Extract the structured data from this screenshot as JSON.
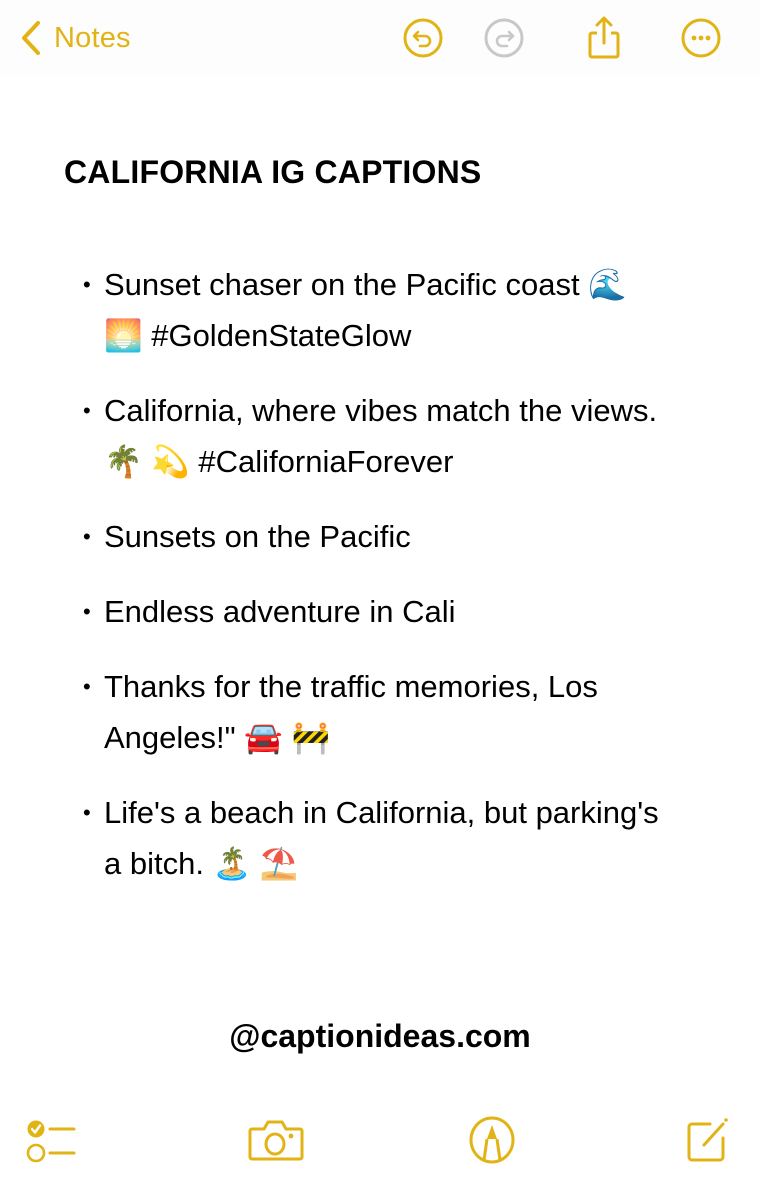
{
  "app": {
    "name": "Notes",
    "accent_color": "#e2b315",
    "disabled_color": "#c8c8c8"
  },
  "top_toolbar": {
    "back_label": "Notes",
    "buttons": [
      {
        "name": "undo",
        "icon": "undo-circle-icon",
        "enabled": true
      },
      {
        "name": "redo",
        "icon": "redo-circle-icon",
        "enabled": false
      },
      {
        "name": "share",
        "icon": "share-icon",
        "enabled": true
      },
      {
        "name": "more",
        "icon": "ellipsis-circle-icon",
        "enabled": true
      }
    ]
  },
  "note": {
    "title": "CALIFORNIA IG CAPTIONS",
    "bullet_symbol": "•",
    "captions": [
      {
        "text": "Sunset chaser on the Pacific coast 🌊 🌅  #GoldenStateGlow"
      },
      {
        "text": "California, where vibes match the views. 🌴 💫  #CaliforniaForever"
      },
      {
        "text": "Sunsets on the Pacific"
      },
      {
        "text": "Endless adventure in Cali"
      },
      {
        "text": "Thanks for the traffic memories, Los Angeles!\" 🚘 🚧"
      },
      {
        "text": "Life's a beach in California, but parking's a bitch. 🏝️ ⛱️"
      }
    ],
    "footer_credit": "@captionideas.com"
  },
  "bottom_toolbar": {
    "buttons": [
      {
        "name": "checklist",
        "icon": "checklist-icon"
      },
      {
        "name": "camera",
        "icon": "camera-icon"
      },
      {
        "name": "markup",
        "icon": "markup-pen-icon"
      },
      {
        "name": "compose",
        "icon": "compose-icon"
      }
    ]
  }
}
